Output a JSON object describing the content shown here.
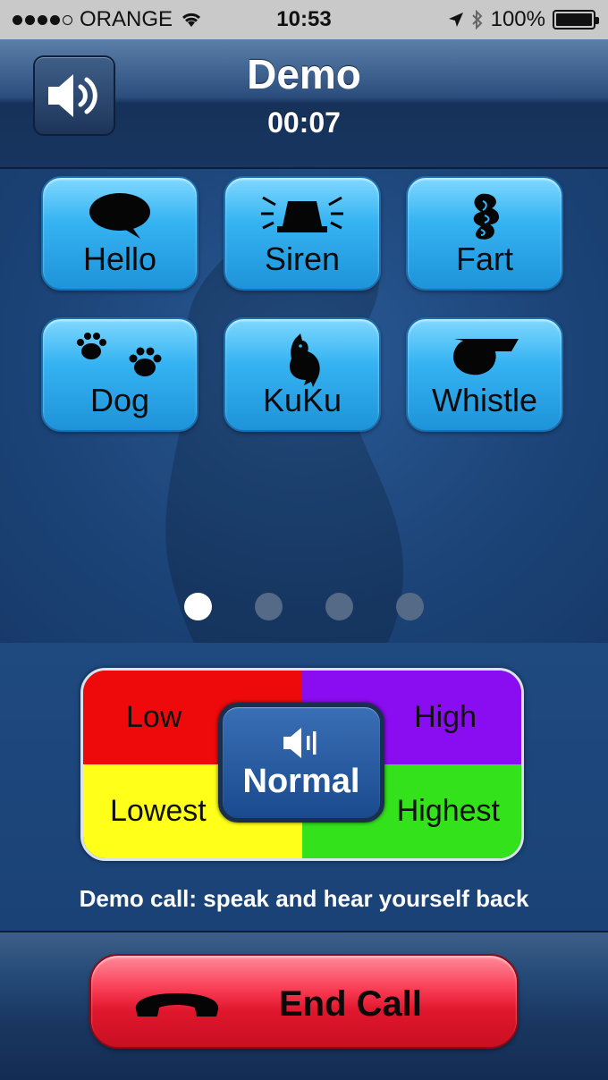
{
  "status_bar": {
    "carrier": "ORANGE",
    "time": "10:53",
    "battery": "100%",
    "signal_bars": 4,
    "signal_total": 5
  },
  "header": {
    "title": "Demo",
    "timer": "00:07"
  },
  "sounds": [
    {
      "label": "Hello",
      "icon": "speech-bubble-icon"
    },
    {
      "label": "Siren",
      "icon": "siren-icon"
    },
    {
      "label": "Fart",
      "icon": "fart-icon"
    },
    {
      "label": "Dog",
      "icon": "paw-icon"
    },
    {
      "label": "KuKu",
      "icon": "bird-icon"
    },
    {
      "label": "Whistle",
      "icon": "whistle-icon"
    }
  ],
  "pager": {
    "pages": 4,
    "current": 1
  },
  "pitch": {
    "low": "Low",
    "high": "High",
    "lowest": "Lowest",
    "highest": "Highest",
    "normal": "Normal",
    "colors": {
      "low": "#ee0a0a",
      "high": "#8a0cf0",
      "lowest": "#ffff1a",
      "highest": "#33e21a"
    }
  },
  "demo_message": "Demo call: speak and hear yourself back",
  "end_call": {
    "label": "End Call",
    "color": "#e0172d"
  }
}
